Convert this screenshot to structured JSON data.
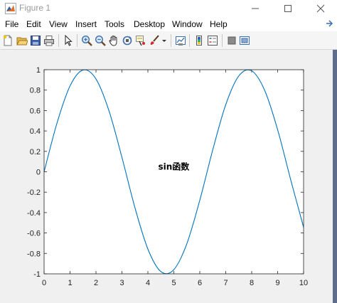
{
  "window": {
    "title": "Figure 1"
  },
  "menu": [
    "File",
    "Edit",
    "View",
    "Insert",
    "Tools",
    "Desktop",
    "Window",
    "Help"
  ],
  "toolbar": {
    "buttons": [
      "new-figure",
      "open-file",
      "save",
      "print",
      "edit-plot",
      "zoom-in",
      "zoom-out",
      "pan",
      "rotate-3d",
      "data-cursor",
      "brush",
      "link-plot",
      "insert-colorbar",
      "insert-legend",
      "hide-plot-tools",
      "show-plot-tools"
    ]
  },
  "chart_data": {
    "type": "line",
    "title": "",
    "xlabel": "",
    "ylabel": "",
    "xlim": [
      0,
      10
    ],
    "ylim": [
      -1,
      1
    ],
    "x_ticks": [
      "0",
      "1",
      "2",
      "3",
      "4",
      "5",
      "6",
      "7",
      "8",
      "9",
      "10"
    ],
    "y_ticks": [
      "-1",
      "-0.8",
      "-0.6",
      "-0.4",
      "-0.2",
      "0",
      "0.2",
      "0.4",
      "0.6",
      "0.8",
      "1"
    ],
    "series": [
      {
        "color": "#0072bd",
        "x": [
          0,
          0.5,
          1,
          1.5,
          2,
          2.5,
          3,
          3.5,
          4,
          4.5,
          5,
          5.5,
          6,
          6.5,
          7,
          7.5,
          8,
          8.5,
          9,
          9.5,
          10
        ],
        "y": [
          0,
          0.479,
          0.841,
          0.997,
          0.909,
          0.598,
          0.141,
          -0.351,
          -0.757,
          -0.978,
          -0.959,
          -0.706,
          -0.279,
          0.215,
          0.657,
          0.938,
          0.989,
          0.798,
          0.412,
          -0.075,
          -0.544
        ]
      }
    ],
    "annotations": [
      {
        "text": "sin函数",
        "x": 5,
        "y": 0.05
      }
    ],
    "grid": false
  }
}
